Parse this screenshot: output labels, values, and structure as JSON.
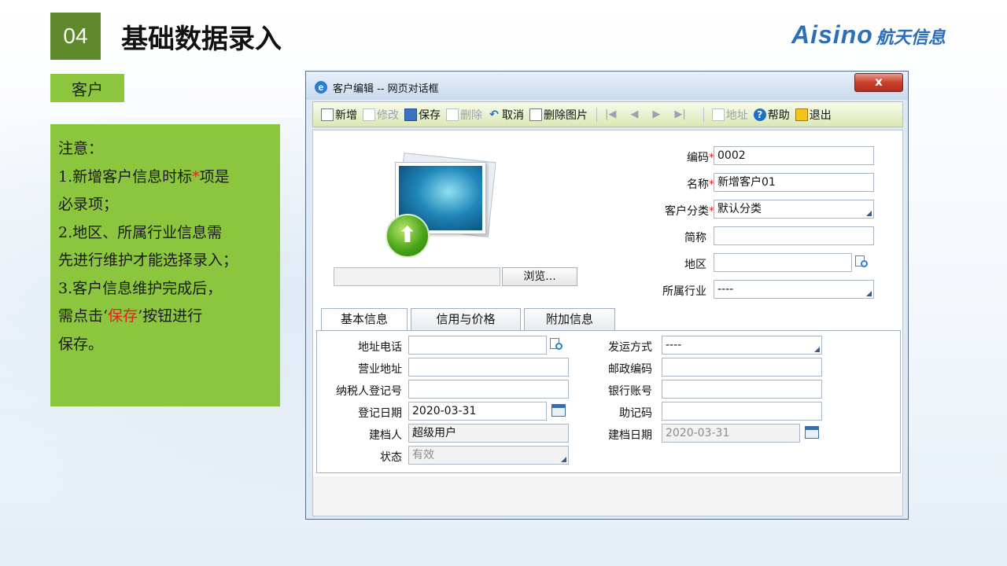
{
  "slide": {
    "number": "04",
    "title": "基础数据录入",
    "brand_en": "Aisino",
    "brand_cn": "航天信息",
    "tag": "客户"
  },
  "note": {
    "line1": "注意：",
    "line2_pre": "1.新增客户信息时标",
    "line2_star": "*",
    "line2_post": "项是",
    "line3": "必录项；",
    "line4": "2.地区、所属行业信息需",
    "line5": "先进行维护才能选择录入；",
    "line6": "3.客户信息维护完成后，",
    "line7_pre": "需点击‘",
    "line7_red": "保存",
    "line7_post": "’按钮进行",
    "line8": "保存。"
  },
  "dialog": {
    "title": "客户编辑 -- 网页对话框",
    "close": "x",
    "toolbar": {
      "new": "新增",
      "edit": "修改",
      "save": "保存",
      "delete": "删除",
      "cancel": "取消",
      "delete_image": "删除图片",
      "nav_first": "|◀",
      "nav_prev": "◀",
      "nav_next": "▶",
      "nav_last": "▶|",
      "address": "地址",
      "help": "帮助",
      "exit": "退出"
    },
    "browse": "浏览...",
    "header_fields": {
      "code_label": "编码",
      "code_value": "0002",
      "name_label": "名称",
      "name_value": "新增客户01",
      "category_label": "客户分类",
      "category_value": "默认分类",
      "short_label": "简称",
      "short_value": "",
      "region_label": "地区",
      "region_value": "",
      "industry_label": "所属行业",
      "industry_value": "----"
    },
    "tabs": [
      "基本信息",
      "信用与价格",
      "附加信息"
    ],
    "basic": {
      "addr_phone_label": "地址电话",
      "addr_phone_value": "",
      "business_addr_label": "营业地址",
      "business_addr_value": "",
      "tax_id_label": "纳税人登记号",
      "tax_id_value": "",
      "reg_date_label": "登记日期",
      "reg_date_value": "2020-03-31",
      "creator_label": "建档人",
      "creator_value": "超级用户",
      "status_label": "状态",
      "status_value": "有效",
      "shipping_label": "发运方式",
      "shipping_value": "----",
      "postcode_label": "邮政编码",
      "postcode_value": "",
      "bank_label": "银行账号",
      "bank_value": "",
      "mnemonic_label": "助记码",
      "mnemonic_value": "",
      "create_date_label": "建档日期",
      "create_date_value": "2020-03-31"
    }
  }
}
